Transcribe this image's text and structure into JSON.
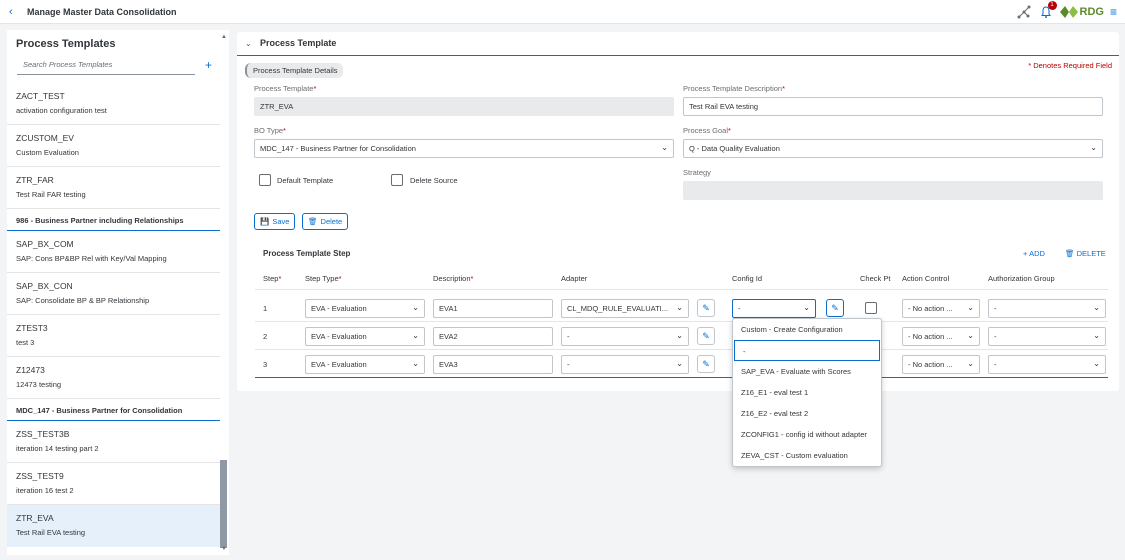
{
  "header": {
    "title": "Manage Master Data Consolidation",
    "notification_count": "1",
    "logo_text": "RDG"
  },
  "master": {
    "title": "Process Templates",
    "search_placeholder": "Search Process Templates",
    "items_a": [
      {
        "name": "ZACT_TEST",
        "desc": "activation configuration test"
      },
      {
        "name": "ZCUSTOM_EV",
        "desc": "Custom Evaluation"
      },
      {
        "name": "ZTR_FAR",
        "desc": "Test Rail FAR testing"
      }
    ],
    "group_b": "986 - Business Partner including Relationships",
    "items_b": [
      {
        "name": "SAP_BX_COM",
        "desc": "SAP: Cons BP&BP Rel with Key/Val Mapping"
      },
      {
        "name": "SAP_BX_CON",
        "desc": "SAP: Consolidate BP & BP Relationship"
      },
      {
        "name": "ZTEST3",
        "desc": "test 3"
      },
      {
        "name": "Z12473",
        "desc": "12473 testing"
      }
    ],
    "group_c": "MDC_147 - Business Partner for Consolidation",
    "items_c": [
      {
        "name": "ZSS_TEST3B",
        "desc": "iteration 14 testing part 2"
      },
      {
        "name": "ZSS_TEST9",
        "desc": "iteration 16 test 2"
      },
      {
        "name": "ZTR_EVA",
        "desc": "Test Rail EVA testing"
      }
    ]
  },
  "detail": {
    "section_title": "Process Template",
    "tab": "Process Template Details",
    "required_note": "* Denotes Required Field",
    "labels": {
      "template": "Process Template",
      "description": "Process Template Description",
      "bo_type": "BO Type",
      "goal": "Process Goal",
      "strategy": "Strategy",
      "default_template": "Default Template",
      "delete_source": "Delete Source"
    },
    "values": {
      "template": "ZTR_EVA",
      "description": "Test Rail EVA testing",
      "bo_type": "MDC_147 - Business Partner for Consolidation",
      "goal": "Q - Data Quality Evaluation",
      "strategy": ""
    },
    "buttons": {
      "save": "Save",
      "delete": "Delete"
    },
    "steps": {
      "title": "Process Template Step",
      "add": "ADD",
      "delete": "DELETE",
      "columns": {
        "step": "Step",
        "step_type": "Step Type",
        "description": "Description",
        "adapter": "Adapter",
        "config_id": "Config Id",
        "check_pt": "Check Pt",
        "action_control": "Action Control",
        "auth_group": "Authorization Group"
      },
      "rows": [
        {
          "step": "1",
          "type": "EVA - Evaluation",
          "desc": "EVA1",
          "adapter": "CL_MDQ_RULE_EVALUATI...",
          "config": "-",
          "action": "- No action ...",
          "auth": "-"
        },
        {
          "step": "2",
          "type": "EVA - Evaluation",
          "desc": "EVA2",
          "adapter": "-",
          "config": "",
          "action": "- No action ...",
          "auth": "-"
        },
        {
          "step": "3",
          "type": "EVA - Evaluation",
          "desc": "EVA3",
          "adapter": "-",
          "config": "",
          "action": "- No action ...",
          "auth": "-"
        }
      ]
    },
    "config_options": [
      "Custom - Create Configuration",
      "-",
      "SAP_EVA - Evaluate with Scores",
      "Z16_E1 - eval test 1",
      "Z16_E2 - eval test 2",
      "ZCONFIG1 - config id without adapter",
      "ZEVA_CST - Custom evaluation"
    ]
  },
  "colors": {
    "accent": "#0a6ed1",
    "required": "#bb0000",
    "selected_bg": "#e5f0fa"
  }
}
